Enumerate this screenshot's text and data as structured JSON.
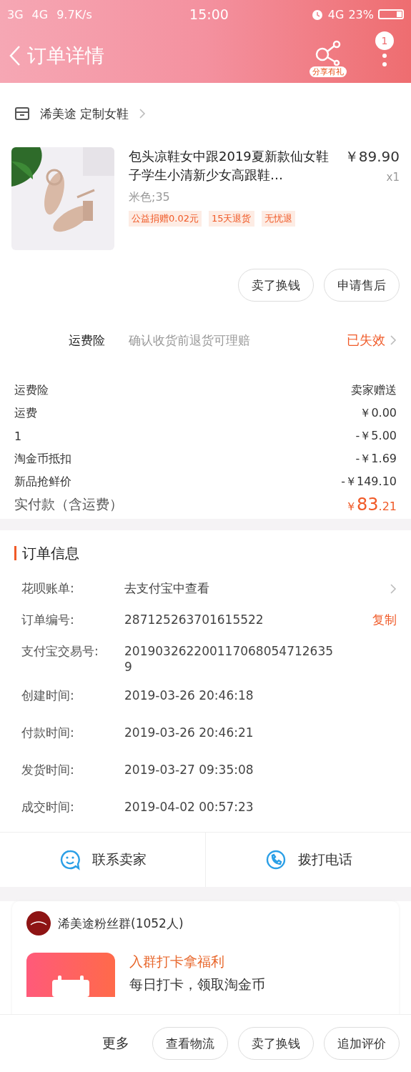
{
  "status_bar": {
    "left": [
      "3G",
      "4G",
      "9.7K/s"
    ],
    "time": "15:00",
    "network": "4G",
    "battery": "23%"
  },
  "header": {
    "title": "订单详情",
    "share_label": "分享有礼",
    "badge": "1"
  },
  "store": {
    "name": "浠美途 定制女鞋"
  },
  "product": {
    "kind": "picture",
    "title": "包头凉鞋女中跟2019夏新款仙女鞋子学生小清新少女高跟鞋…",
    "price": "￥89.90",
    "quantity": "x1",
    "spec": "米色;35",
    "tags": [
      "公益捐赠0.02元",
      "15天退货",
      "无忧退"
    ],
    "actions": [
      "卖了换钱",
      "申请售后"
    ]
  },
  "insurance": {
    "label": "运费险",
    "desc": "确认收货前退货可理赔",
    "status": "已失效"
  },
  "fees": [
    {
      "label": "运费险",
      "value": "卖家赠送"
    },
    {
      "label": "运费",
      "value": "￥0.00"
    },
    {
      "label": "1",
      "value": "-￥5.00"
    },
    {
      "label": "淘金币抵扣",
      "value": "-￥1.69"
    },
    {
      "label": "新品抢鲜价",
      "value": "-￥149.10"
    }
  ],
  "total": {
    "label": "实付款（含运费）",
    "currency": "￥",
    "integer": "83",
    "decimal": ".21"
  },
  "order_info": {
    "title": "订单信息",
    "rows": [
      {
        "kind": "link",
        "label": "花呗账单:",
        "value": "去支付宝中查看"
      },
      {
        "kind": "copy",
        "label": "订单编号:",
        "value": "287125263701615522",
        "action": "复制"
      },
      {
        "kind": "plain",
        "label": "支付宝交易号:",
        "value": "2019032622001170680547126359"
      },
      {
        "kind": "plain",
        "label": "创建时间:",
        "value": "2019-03-26 20:46:18"
      },
      {
        "kind": "plain",
        "label": "付款时间:",
        "value": "2019-03-26 20:46:21"
      },
      {
        "kind": "plain",
        "label": "发货时间:",
        "value": "2019-03-27 09:35:08"
      },
      {
        "kind": "plain",
        "label": "成交时间:",
        "value": "2019-04-02 00:57:23"
      }
    ]
  },
  "contact": [
    {
      "kind": "chat",
      "label": "联系卖家"
    },
    {
      "kind": "phone",
      "label": "拨打电话"
    }
  ],
  "fan_group": {
    "name": "浠美途粉丝群(1052人)",
    "promo_title": "入群打卡拿福利",
    "promo_desc": "每日打卡，领取淘金币"
  },
  "bottom_bar": {
    "more": "更多",
    "buttons": [
      "查看物流",
      "卖了换钱",
      "追加评价"
    ]
  }
}
